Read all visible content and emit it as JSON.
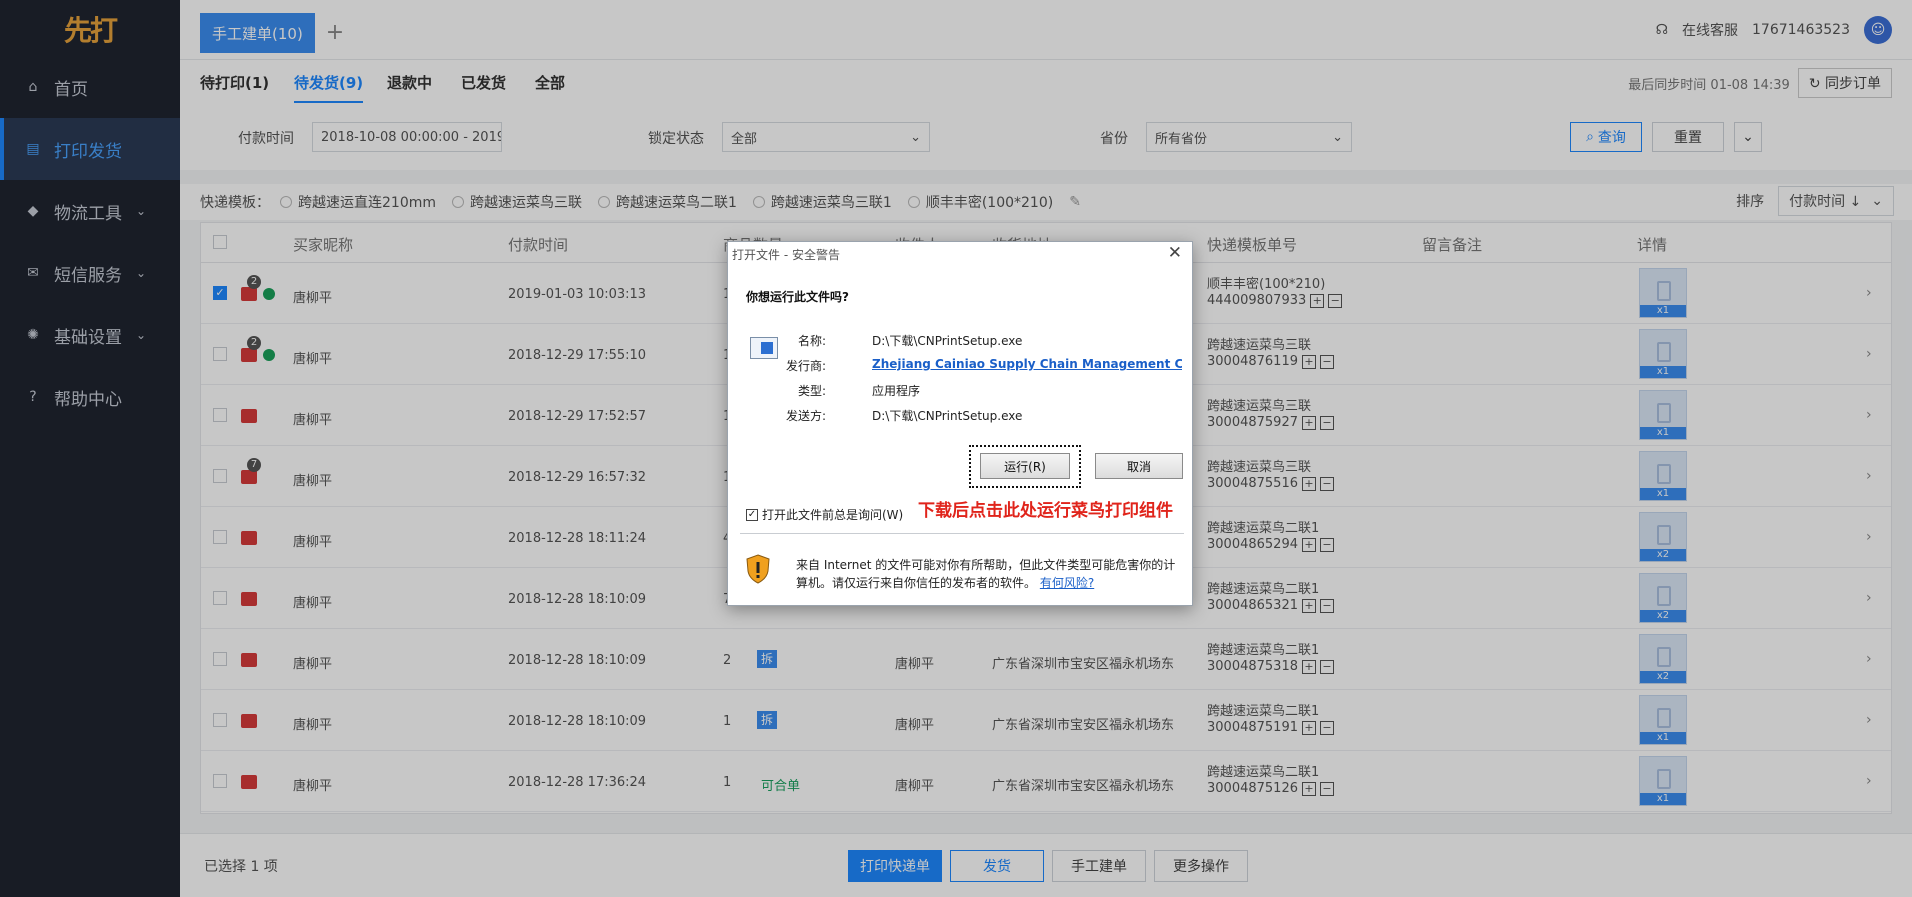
{
  "sidebar": {
    "logo": "先打",
    "items": [
      {
        "label": "首页",
        "icon": "home-icon"
      },
      {
        "label": "打印发货",
        "icon": "printer-icon"
      },
      {
        "label": "物流工具",
        "icon": "box-icon"
      },
      {
        "label": "短信服务",
        "icon": "mail-icon"
      },
      {
        "label": "基础设置",
        "icon": "gear-icon"
      },
      {
        "label": "帮助中心",
        "icon": "help-icon"
      }
    ]
  },
  "topbar": {
    "tab": "手工建单(10)",
    "add": "+",
    "service": "在线客服",
    "phone": "17671463523"
  },
  "status_tabs": [
    "待打印(1)",
    "待发货(9)",
    "退款中",
    "已发货",
    "全部"
  ],
  "sync": {
    "last": "最后同步时间 01-08 14:39",
    "button": "同步订单"
  },
  "filter": {
    "pay_time_label": "付款时间",
    "pay_time_value": "2018-10-08 00:00:00 - 2019-0",
    "lock_label": "锁定状态",
    "lock_value": "全部",
    "province_label": "省份",
    "province_value": "所有省份",
    "query": "查询",
    "reset": "重置"
  },
  "templates": {
    "label": "快递模板：",
    "options": [
      "跨越速运直连210mm",
      "跨越速运菜鸟三联",
      "跨越速运菜鸟二联1",
      "跨越速运菜鸟三联1",
      "顺丰丰密(100*210)"
    ],
    "sort_label": "排序",
    "sort_value": "付款时间 ↓"
  },
  "table": {
    "headers": [
      "买家昵称",
      "付款时间",
      "商品数量",
      "收件人",
      "收货地址",
      "快递模板单号",
      "留言备注",
      "详情"
    ],
    "rows": [
      {
        "buyer": "唐柳平",
        "time": "2019-01-03 10:03:13",
        "qty": "1",
        "tag": "",
        "receiver": "",
        "address": "",
        "tpl": "顺丰丰密(100*210)",
        "no": "444009807933",
        "count": "x1",
        "checked": true,
        "badge": "2"
      },
      {
        "buyer": "唐柳平",
        "time": "2018-12-29 17:55:10",
        "qty": "1",
        "tag": "",
        "receiver": "",
        "address": "",
        "tpl": "跨越速运菜鸟三联",
        "no": "30004876119",
        "count": "x1",
        "checked": false,
        "badge": "2"
      },
      {
        "buyer": "唐柳平",
        "time": "2018-12-29 17:52:57",
        "qty": "1",
        "tag": "",
        "receiver": "",
        "address": "",
        "tpl": "跨越速运菜鸟三联",
        "no": "30004875927",
        "count": "x1",
        "checked": false,
        "badge": ""
      },
      {
        "buyer": "唐柳平",
        "time": "2018-12-29 16:57:32",
        "qty": "1",
        "tag": "",
        "receiver": "",
        "address": "",
        "tpl": "跨越速运菜鸟三联",
        "no": "30004875516",
        "count": "x1",
        "checked": false,
        "badge": "7"
      },
      {
        "buyer": "唐柳平",
        "time": "2018-12-28 18:11:24",
        "qty": "4",
        "tag": "",
        "receiver": "",
        "address": "",
        "tpl": "跨越速运菜鸟二联1",
        "no": "30004865294",
        "count": "x2",
        "checked": false,
        "badge": ""
      },
      {
        "buyer": "唐柳平",
        "time": "2018-12-28 18:10:09",
        "qty": "7",
        "tag": "",
        "receiver": "",
        "address": "",
        "tpl": "跨越速运菜鸟二联1",
        "no": "30004865321",
        "count": "x2",
        "checked": false,
        "badge": ""
      },
      {
        "buyer": "唐柳平",
        "time": "2018-12-28 18:10:09",
        "qty": "2",
        "tag": "拆",
        "receiver": "唐柳平",
        "address": "广东省深圳市宝安区福永机场东",
        "tpl": "跨越速运菜鸟二联1",
        "no": "30004875318",
        "count": "x2",
        "checked": false,
        "badge": ""
      },
      {
        "buyer": "唐柳平",
        "time": "2018-12-28 18:10:09",
        "qty": "1",
        "tag": "拆",
        "receiver": "唐柳平",
        "address": "广东省深圳市宝安区福永机场东",
        "tpl": "跨越速运菜鸟二联1",
        "no": "30004875191",
        "count": "x1",
        "checked": false,
        "badge": ""
      },
      {
        "buyer": "唐柳平",
        "time": "2018-12-28 17:36:24",
        "qty": "1",
        "tag": "可合单",
        "receiver": "唐柳平",
        "address": "广东省深圳市宝安区福永机场东",
        "tpl": "跨越速运菜鸟二联1",
        "no": "30004875126",
        "count": "x1",
        "checked": false,
        "badge": ""
      }
    ]
  },
  "bottom": {
    "selected": "已选择 1 项",
    "print": "打印快递单",
    "ship": "发货",
    "manual": "手工建单",
    "more": "更多操作"
  },
  "dialog": {
    "title": "打开文件 - 安全警告",
    "question": "你想运行此文件吗?",
    "name_k": "名称:",
    "name_v": "D:\\下载\\CNPrintSetup.exe",
    "publisher_k": "发行商:",
    "publisher_v": "Zhejiang Cainiao Supply Chain Management C...",
    "type_k": "类型:",
    "type_v": "应用程序",
    "from_k": "发送方:",
    "from_v": "D:\\下载\\CNPrintSetup.exe",
    "run": "运行(R)",
    "cancel": "取消",
    "ask": "打开此文件前总是询问(W)",
    "annotation": "下载后点击此处运行菜鸟打印组件",
    "warning": "来自 Internet 的文件可能对你有所帮助，但此文件类型可能危害你的计算机。请仅运行来自你信任的发布者的软件。",
    "risk_link": "有何风险?"
  }
}
